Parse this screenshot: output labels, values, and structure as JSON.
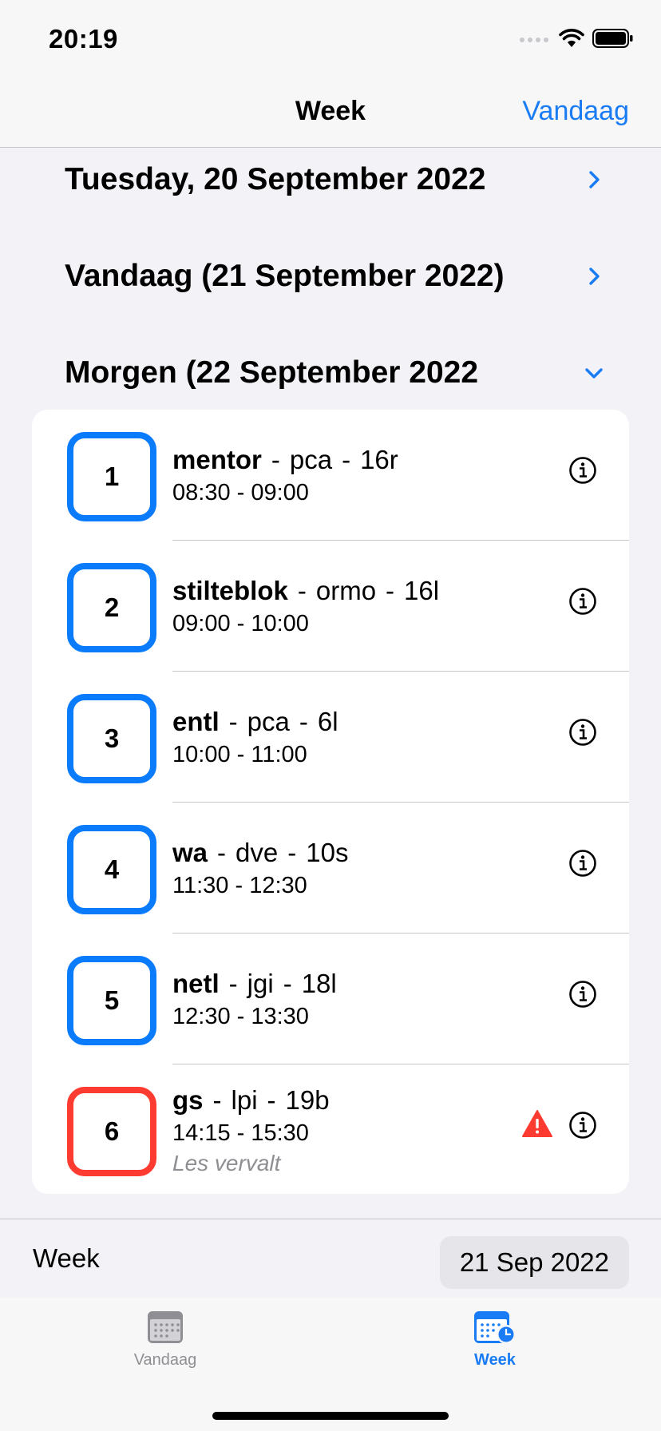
{
  "status": {
    "time": "20:19"
  },
  "nav": {
    "title": "Week",
    "action": "Vandaag"
  },
  "days": [
    {
      "title": "Tuesday, 20 September 2022",
      "expanded": false
    },
    {
      "title": "Vandaag (21 September 2022)",
      "expanded": false
    },
    {
      "title": "Morgen (22 September 2022",
      "expanded": true
    }
  ],
  "lessons": [
    {
      "number": "1",
      "subject": "mentor",
      "teacher": "pca",
      "room": "16r",
      "time": "08:30 - 09:00",
      "color": "#0a7cfb"
    },
    {
      "number": "2",
      "subject": "stilteblok",
      "teacher": "ormo",
      "room": "16l",
      "time": "09:00 - 10:00",
      "color": "#0a7cfb"
    },
    {
      "number": "3",
      "subject": "entl",
      "teacher": "pca",
      "room": "6l",
      "time": "10:00 - 11:00",
      "color": "#0a7cfb"
    },
    {
      "number": "4",
      "subject": "wa",
      "teacher": "dve",
      "room": "10s",
      "time": "11:30 - 12:30",
      "color": "#0a7cfb"
    },
    {
      "number": "5",
      "subject": "netl",
      "teacher": "jgi",
      "room": "18l",
      "time": "12:30 - 13:30",
      "color": "#0a7cfb"
    },
    {
      "number": "6",
      "subject": "gs",
      "teacher": "lpi",
      "room": "19b",
      "time": "14:15 - 15:30",
      "note": "Les vervalt",
      "color": "#fe3b30",
      "warning": true
    }
  ],
  "separator": "-",
  "week_picker": {
    "label": "Week",
    "date": "21 Sep 2022"
  },
  "tabs": [
    {
      "label": "Vandaag",
      "icon": "calendar-icon",
      "active": false
    },
    {
      "label": "Week",
      "icon": "calendar-clock-icon",
      "active": true
    }
  ],
  "colors": {
    "accent": "#1a7cf5",
    "cancelled": "#fe3b30",
    "inactive_tab": "#8e8e93"
  }
}
